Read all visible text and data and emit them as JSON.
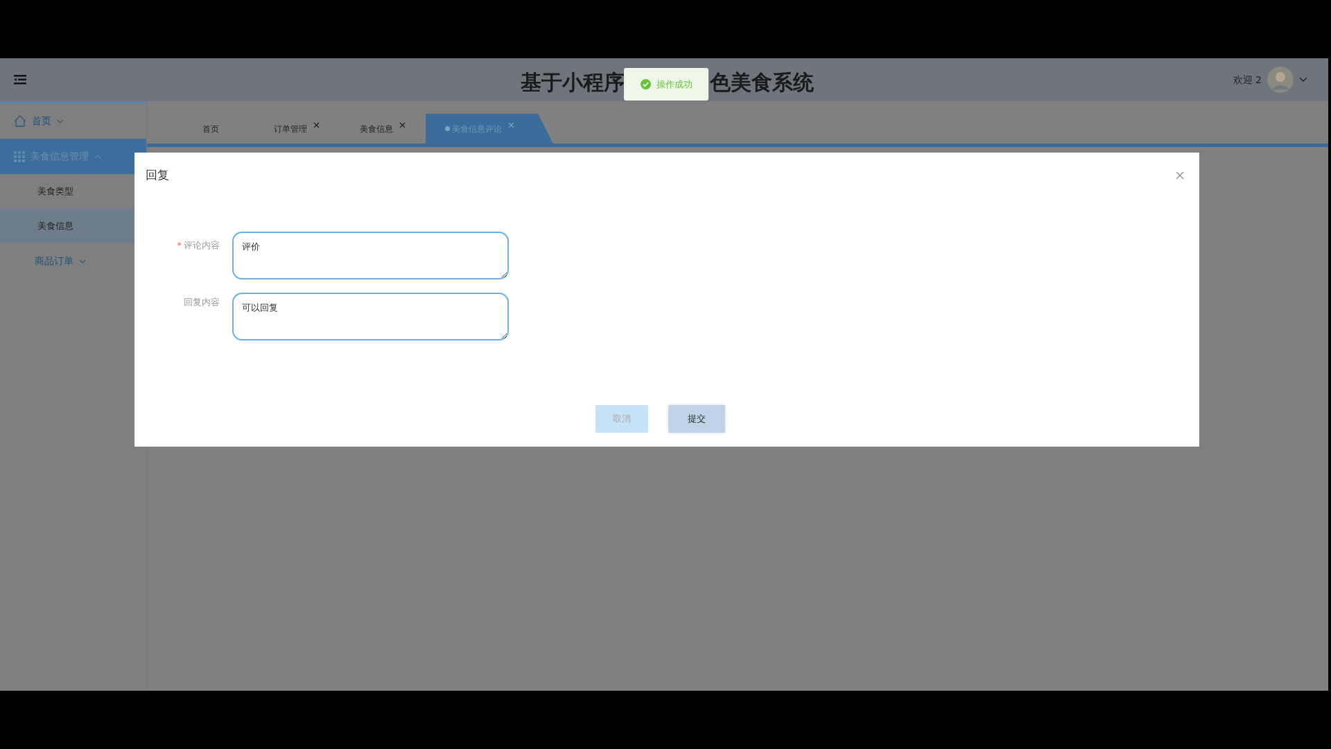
{
  "header": {
    "title_parts": [
      "基于小程序",
      "色美食系统"
    ],
    "greeting": "欢迎 2"
  },
  "toast": {
    "message": "操作成功",
    "kind": "success"
  },
  "sidebar": {
    "items": [
      {
        "label": "首页",
        "expanded": false,
        "selected": false
      },
      {
        "label": "美食信息管理",
        "expanded": true,
        "selected": true,
        "children": [
          {
            "label": "美食类型",
            "selected": false
          },
          {
            "label": "美食信息",
            "selected": true
          }
        ]
      },
      {
        "label": "商品订单",
        "expanded": false,
        "selected": false
      }
    ]
  },
  "tabs": [
    {
      "label": "首页",
      "closable": false,
      "selected": false
    },
    {
      "label": "订单管理",
      "closable": true,
      "selected": false
    },
    {
      "label": "美食信息",
      "closable": true,
      "selected": false
    },
    {
      "label": "美食信息评论",
      "closable": true,
      "selected": true
    }
  ],
  "dialog": {
    "title": "回复",
    "fields": [
      {
        "marker": "*",
        "label": "评论内容",
        "value": "评价"
      },
      {
        "label": "回复内容",
        "value": "可以回复"
      }
    ],
    "buttons": [
      {
        "label": "取消",
        "kind": "cancel"
      },
      {
        "label": "提交",
        "kind": "primary"
      }
    ]
  }
}
